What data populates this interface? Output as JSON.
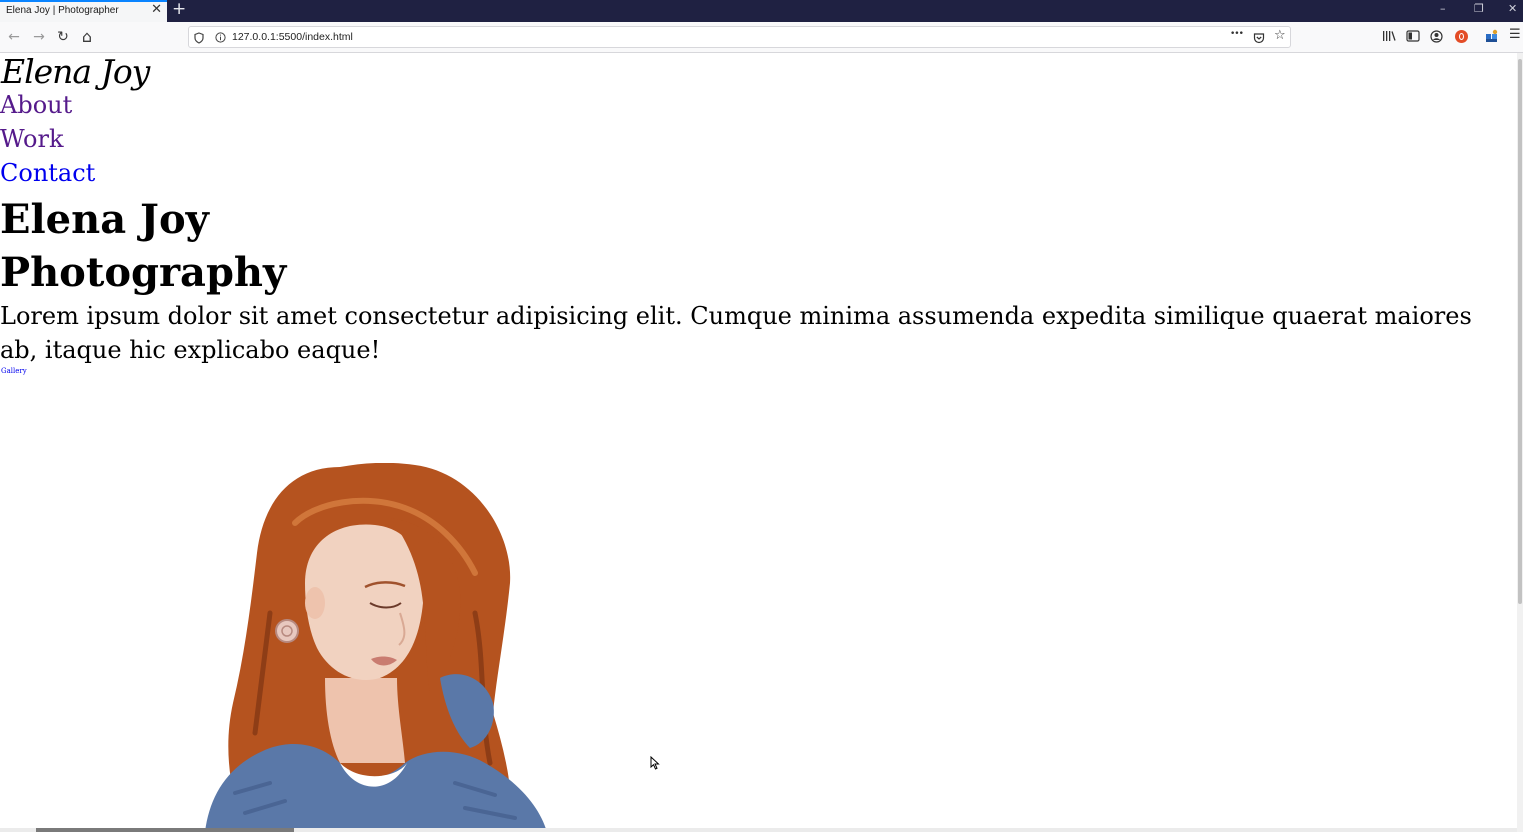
{
  "browser": {
    "tab_title": "Elena Joy | Photographer",
    "close_glyph": "✕",
    "new_tab_glyph": "+",
    "window": {
      "minimize": "–",
      "restore": "❐",
      "close": "✕"
    },
    "nav": {
      "back": "←",
      "forward": "→",
      "reload": "↻",
      "home": "⌂"
    },
    "url": "127.0.0.1:5500/index.html",
    "page_actions": {
      "more": "•••",
      "pocket": "▿",
      "bookmark": "☆"
    },
    "toolbar": {
      "library": "⫼",
      "sidebar": "▣",
      "account": "◉",
      "extension": "✦",
      "menu": "☰"
    }
  },
  "page": {
    "logo": "Elena Joy",
    "nav_links": [
      "About",
      "Work",
      "Contact"
    ],
    "heading_line1": "Elena Joy",
    "heading_line2": "Photography",
    "lead": "Lorem ipsum dolor sit amet consectetur adipisicing elit. Cumque minima assumenda expedita similique quaerat maiores ab, itaque hic explicabo eaque!",
    "gallery_link": "Gallery"
  },
  "colors": {
    "titlebar": "#1f2142",
    "visited_link": "#551a8b",
    "link": "#0000ee",
    "hair": "#b5531f",
    "sweater": "#5a78a8",
    "skin": "#f1d2c0"
  }
}
